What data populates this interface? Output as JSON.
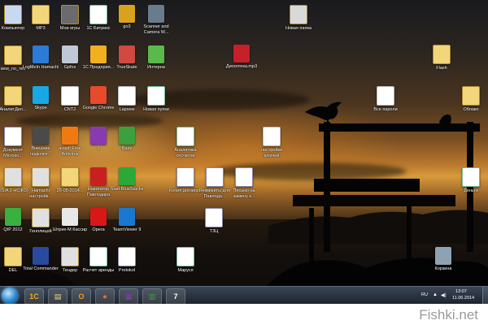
{
  "desktop": {
    "icons": [
      {
        "label": "Компьютер",
        "glyph": "folder",
        "color": "#c8d8ee"
      },
      {
        "label": "MP3",
        "glyph": "folder",
        "color": "#f3d57a"
      },
      {
        "label": "Мои игры",
        "glyph": "folder",
        "color": "#6b6b6b"
      },
      {
        "label": "1С Битрикс",
        "glyph": "xls",
        "color": "#ffffff"
      },
      {
        "label": "go3",
        "glyph": "app",
        "color": "#d8a21c"
      },
      {
        "label": "Scanner and Camera W...",
        "glyph": "app",
        "color": "#6a7c8c"
      },
      {
        "label": "Новая папка",
        "glyph": "folder",
        "color": "#d9d9d9"
      },
      {
        "label": "мои_по_тех",
        "glyph": "folder",
        "color": "#f3d57a"
      },
      {
        "label": "LogMeIn Hamachi",
        "glyph": "app",
        "color": "#2d7bd6"
      },
      {
        "label": "Gpfox",
        "glyph": "app",
        "color": "#c0c8d6"
      },
      {
        "label": "1С Предприя...",
        "glyph": "app",
        "color": "#f0b020"
      },
      {
        "label": "TrueSkate",
        "glyph": "app",
        "color": "#d04a40"
      },
      {
        "label": "Интерна",
        "glyph": "app",
        "color": "#5bb84a"
      },
      {
        "label": "Дискотека.mp3",
        "glyph": "app",
        "color": "#c8202a"
      },
      {
        "label": "Flash",
        "glyph": "folder",
        "color": "#f3d57a"
      },
      {
        "label": "АналитДел...",
        "glyph": "folder",
        "color": "#f3d57a"
      },
      {
        "label": "Skype",
        "glyph": "app",
        "color": "#18a8e6"
      },
      {
        "label": "CNT2",
        "glyph": "txt",
        "color": "#ffffff"
      },
      {
        "label": "Google Chrome",
        "glyph": "app",
        "color": "#e84a2c"
      },
      {
        "label": "Lapsew",
        "glyph": "txt",
        "color": "#ffffff"
      },
      {
        "label": "Новая пупки",
        "glyph": "xls",
        "color": "#ffffff"
      },
      {
        "label": "Все пароли",
        "glyph": "txt",
        "color": "#ffffff"
      },
      {
        "label": "Облако",
        "glyph": "folder",
        "color": "#f3d57a"
      },
      {
        "label": "Документ Microso...",
        "glyph": "word",
        "color": "#ffffff"
      },
      {
        "label": "Внешние подключ...",
        "glyph": "app",
        "color": "#4a4a4a"
      },
      {
        "label": "avast! Free Antivirus",
        "glyph": "app",
        "color": "#f07a10"
      },
      {
        "label": "1",
        "glyph": "app",
        "color": "#8a3ab0"
      },
      {
        "label": "Бару",
        "glyph": "app",
        "color": "#3ca03c"
      },
      {
        "label": "Аналитика отсчетов",
        "glyph": "xls",
        "color": "#ffffff"
      },
      {
        "label": "настройки ключей",
        "glyph": "txt",
        "color": "#ffffff"
      },
      {
        "label": "JISIA 2 НСФО)",
        "glyph": "folder",
        "color": "#e0e0e0"
      },
      {
        "label": "Hamachi настройк...",
        "glyph": "folder",
        "color": "#e0e0e0"
      },
      {
        "label": "26-05-2014...",
        "glyph": "folder",
        "color": "#f3d57a"
      },
      {
        "label": "Навигатор Павлодара",
        "glyph": "app",
        "color": "#c82020"
      },
      {
        "label": "Start BlueStacks",
        "glyph": "app",
        "color": "#2aa838"
      },
      {
        "label": "Копия договора",
        "glyph": "word",
        "color": "#ffffff"
      },
      {
        "label": "Реквизиты для Павлода...",
        "glyph": "word",
        "color": "#ffffff"
      },
      {
        "label": "Письмо на замену к...",
        "glyph": "word",
        "color": "#ffffff"
      },
      {
        "label": "Деньги",
        "glyph": "xls",
        "color": "#ffffff"
      },
      {
        "label": "QIP 2012",
        "glyph": "app",
        "color": "#3ab040"
      },
      {
        "label": "Генплицей",
        "glyph": "folder",
        "color": "#e0e0e0"
      },
      {
        "label": "Штрих-М Кассир",
        "glyph": "app",
        "color": "#e8e8e8"
      },
      {
        "label": "Opera",
        "glyph": "app",
        "color": "#d81818"
      },
      {
        "label": "TeamViewer 9",
        "glyph": "app",
        "color": "#1a78d0"
      },
      {
        "label": "ТЗЦ",
        "glyph": "word",
        "color": "#ffffff"
      },
      {
        "label": "DEL",
        "glyph": "folder",
        "color": "#f3d57a"
      },
      {
        "label": "Total Commander",
        "glyph": "app",
        "color": "#2a4aa0"
      },
      {
        "label": "Тендер",
        "glyph": "folder",
        "color": "#e0e0e0"
      },
      {
        "label": "Расчет аренды",
        "glyph": "xls",
        "color": "#ffffff"
      },
      {
        "label": "Protokol",
        "glyph": "word",
        "color": "#ffffff"
      },
      {
        "label": "Маруся",
        "glyph": "xls",
        "color": "#ffffff"
      },
      {
        "label": "Корзина",
        "glyph": "app",
        "color": "#8ea2b4"
      }
    ]
  },
  "taskbar": {
    "start": "",
    "buttons": [
      {
        "name": "1c-task",
        "glyph": "1С",
        "color": "#f0b020"
      },
      {
        "name": "explorer-task",
        "glyph": "▤",
        "color": "#f3d57a"
      },
      {
        "name": "outlook-task",
        "glyph": "O",
        "color": "#f09a10"
      },
      {
        "name": "firefox-task",
        "glyph": "●",
        "color": "#f07020"
      },
      {
        "name": "winrar-task",
        "glyph": "▦",
        "color": "#8a3ab0"
      },
      {
        "name": "taskmgr-task",
        "glyph": "▥",
        "color": "#3ca03c"
      },
      {
        "name": "7zip-task",
        "glyph": "7",
        "color": "#ffffff"
      }
    ],
    "tray": {
      "language": "RU",
      "time": "13:07",
      "date": "11.06.2014"
    }
  },
  "watermark": "Fishki.net"
}
